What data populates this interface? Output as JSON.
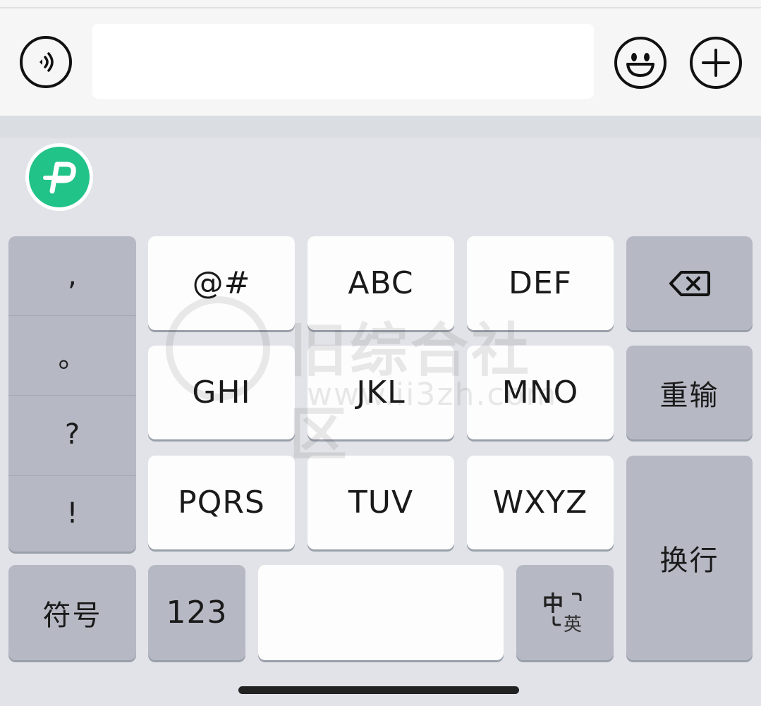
{
  "input_bar": {
    "voice_icon": "voice-icon",
    "text_value": "",
    "emoji_icon": "emoji-icon",
    "plus_icon": "plus-icon"
  },
  "toolbar": {
    "app_logo_icon": "app-logo-icon"
  },
  "keyboard": {
    "punctuation": [
      ",",
      "。",
      "?",
      "!"
    ],
    "keys": {
      "k1": "@#",
      "k2": "ABC",
      "k3": "DEF",
      "k4": "GHI",
      "k5": "JKL",
      "k6": "MNO",
      "k7": "PQRS",
      "k8": "TUV",
      "k9": "WXYZ"
    },
    "backspace_icon": "backspace-icon",
    "retype": "重输",
    "newline": "换行",
    "symbols": "符号",
    "numbers": "123",
    "space": "",
    "lang_primary": "中",
    "lang_secondary": "英"
  },
  "watermark": {
    "text": "旧综合社区",
    "url": "www.ii3zh.com"
  },
  "colors": {
    "accent_green": "#22c389",
    "key_gray": "#b6b9c4",
    "key_white": "#fdfdfd",
    "keyboard_bg": "#e1e3e8"
  }
}
